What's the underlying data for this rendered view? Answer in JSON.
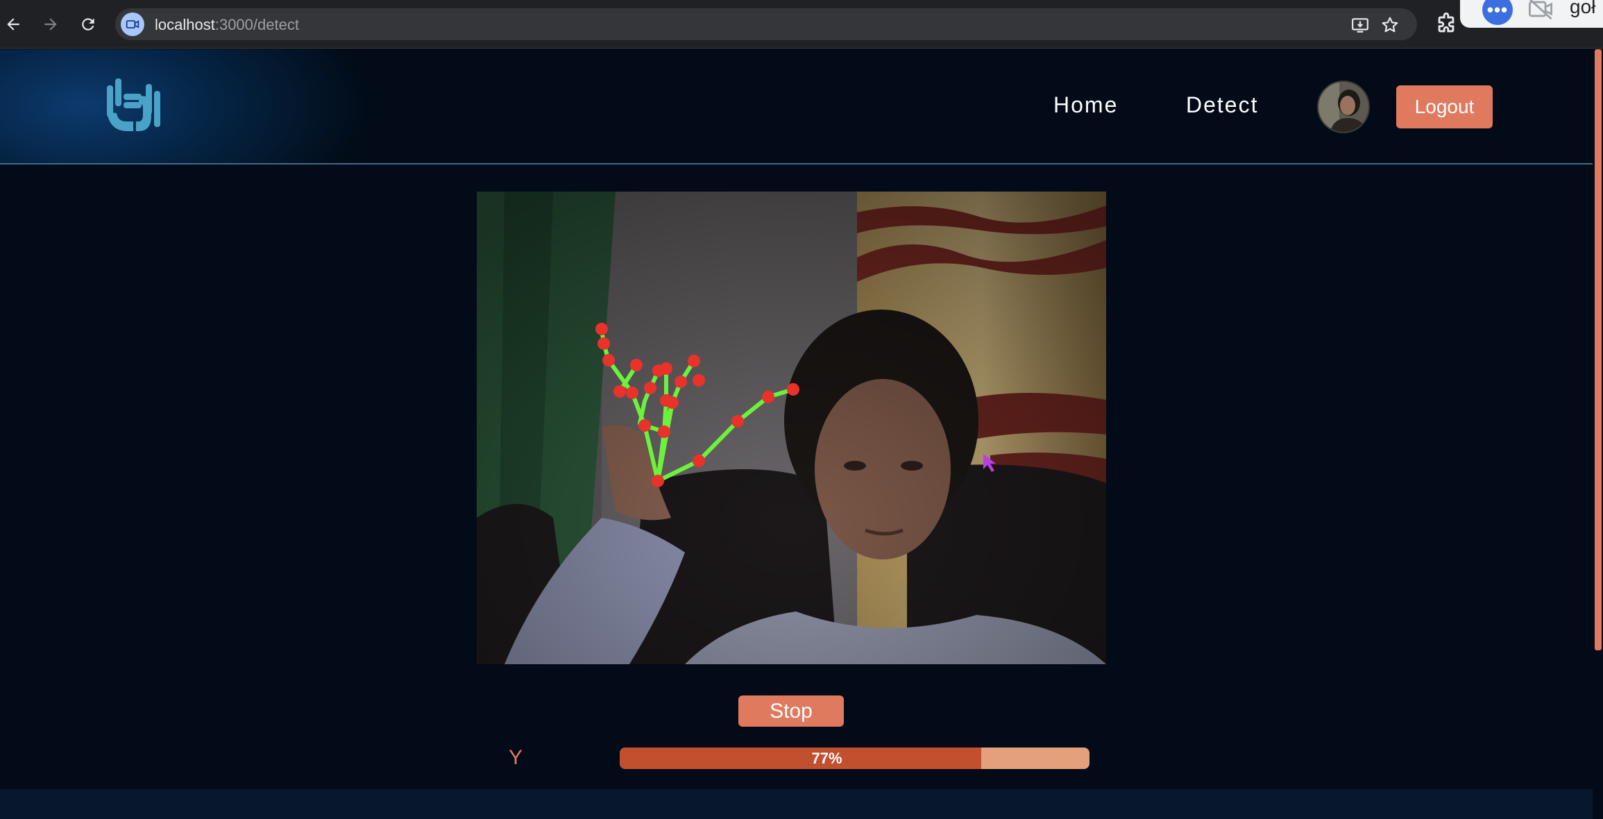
{
  "browser": {
    "url_host": "localhost",
    "url_path": ":3000/detect",
    "overlay_text": "goł"
  },
  "header": {
    "nav": [
      {
        "label": "Home"
      },
      {
        "label": "Detect"
      }
    ],
    "logout_label": "Logout"
  },
  "detection": {
    "stop_label": "Stop",
    "predicted_letter": "Y",
    "confidence": 0.77,
    "confidence_label": "77%"
  },
  "colors": {
    "accent": "#e07a5f",
    "page_bg": "#020b17",
    "progress_fill": "#c2502f",
    "progress_track": "#e3a07a",
    "landmark_point": "#e8322a",
    "landmark_line": "#6df23c"
  },
  "icons": {
    "back": "arrow-left-icon",
    "forward": "arrow-right-icon",
    "reload": "reload-icon",
    "site": "camera-icon",
    "install": "install-app-icon",
    "bookmark": "star-icon",
    "extensions": "puzzle-icon",
    "more": "more-dots-icon",
    "camera_off": "camera-off-icon",
    "logo": "hands-logo-icon"
  }
}
